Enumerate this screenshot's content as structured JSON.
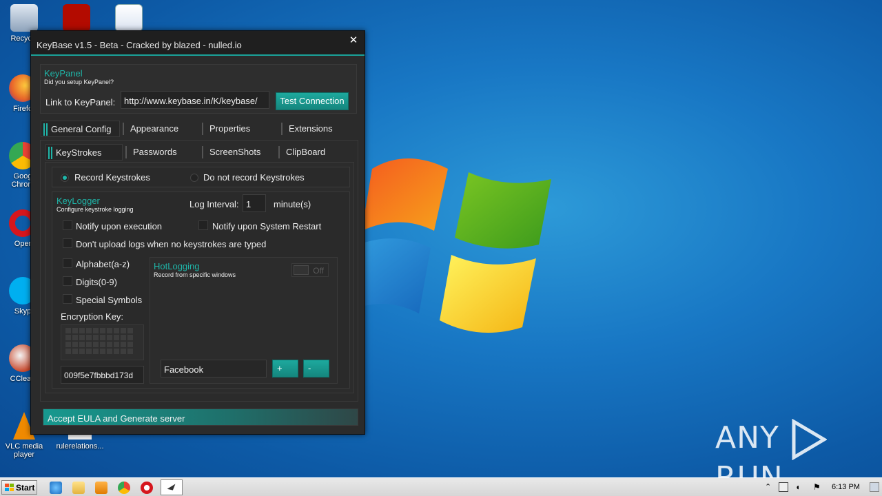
{
  "desktop": {
    "icons": [
      {
        "label": "Recycle",
        "color": "#9fb3c9"
      },
      {
        "label": "Firefo",
        "color": "#e8642a"
      },
      {
        "label": "Goog\nChrom",
        "color": "#34a853"
      },
      {
        "label": "Oper",
        "color": "#d6161d"
      },
      {
        "label": "Skyp",
        "color": "#00aff0"
      },
      {
        "label": "CClean",
        "color": "#c8462a"
      },
      {
        "label": "VLC media player",
        "color": "#f08a00"
      },
      {
        "label": "rulerelations...",
        "color": "#e6e6e6"
      }
    ],
    "watermark": {
      "left": "ANY",
      "right": "RUN"
    }
  },
  "window": {
    "title": "KeyBase v1.5 - Beta - Cracked by blazed - nulled.io",
    "close_glyph": "✕",
    "keypanel": {
      "title": "KeyPanel",
      "subtitle": "Did you setup KeyPanel?",
      "link_label": "Link to KeyPanel:",
      "link_value": "http://www.keybase.in/K/keybase/",
      "test_button": "Test Connection"
    },
    "main_tabs": [
      "General Config",
      "Appearance",
      "Properties",
      "Extensions"
    ],
    "sub_tabs": [
      "KeyStrokes",
      "Passwords",
      "ScreenShots",
      "ClipBoard"
    ],
    "record": {
      "option_on": "Record Keystrokes",
      "option_off": "Do not record Keystrokes",
      "selected": "Record Keystrokes"
    },
    "keylogger": {
      "title": "KeyLogger",
      "subtitle": "Configure keystroke logging",
      "interval_label": "Log Interval:",
      "interval_value": "1",
      "interval_unit": "minute(s)",
      "notify_exec": "Notify upon execution",
      "notify_restart": "Notify upon System Restart",
      "no_upload": "Don't upload logs when no keystrokes are typed",
      "alphabet": "Alphabet(a-z)",
      "digits": "Digits(0-9)",
      "symbols": "Special Symbols",
      "encryption_label": "Encryption Key:",
      "encryption_value": "009f5e7fbbbd173d"
    },
    "hotlogging": {
      "title": "HotLogging",
      "subtitle": "Record from specific windows",
      "toggle_state": "Off",
      "window_value": "Facebook",
      "add_label": "+",
      "remove_label": "-"
    },
    "generate_button": "Accept EULA and Generate server"
  },
  "taskbar": {
    "start_label": "Start",
    "clock": "6:13 PM"
  },
  "colors": {
    "accent": "#1fb5a8",
    "window_bg": "#2b2b2b"
  }
}
